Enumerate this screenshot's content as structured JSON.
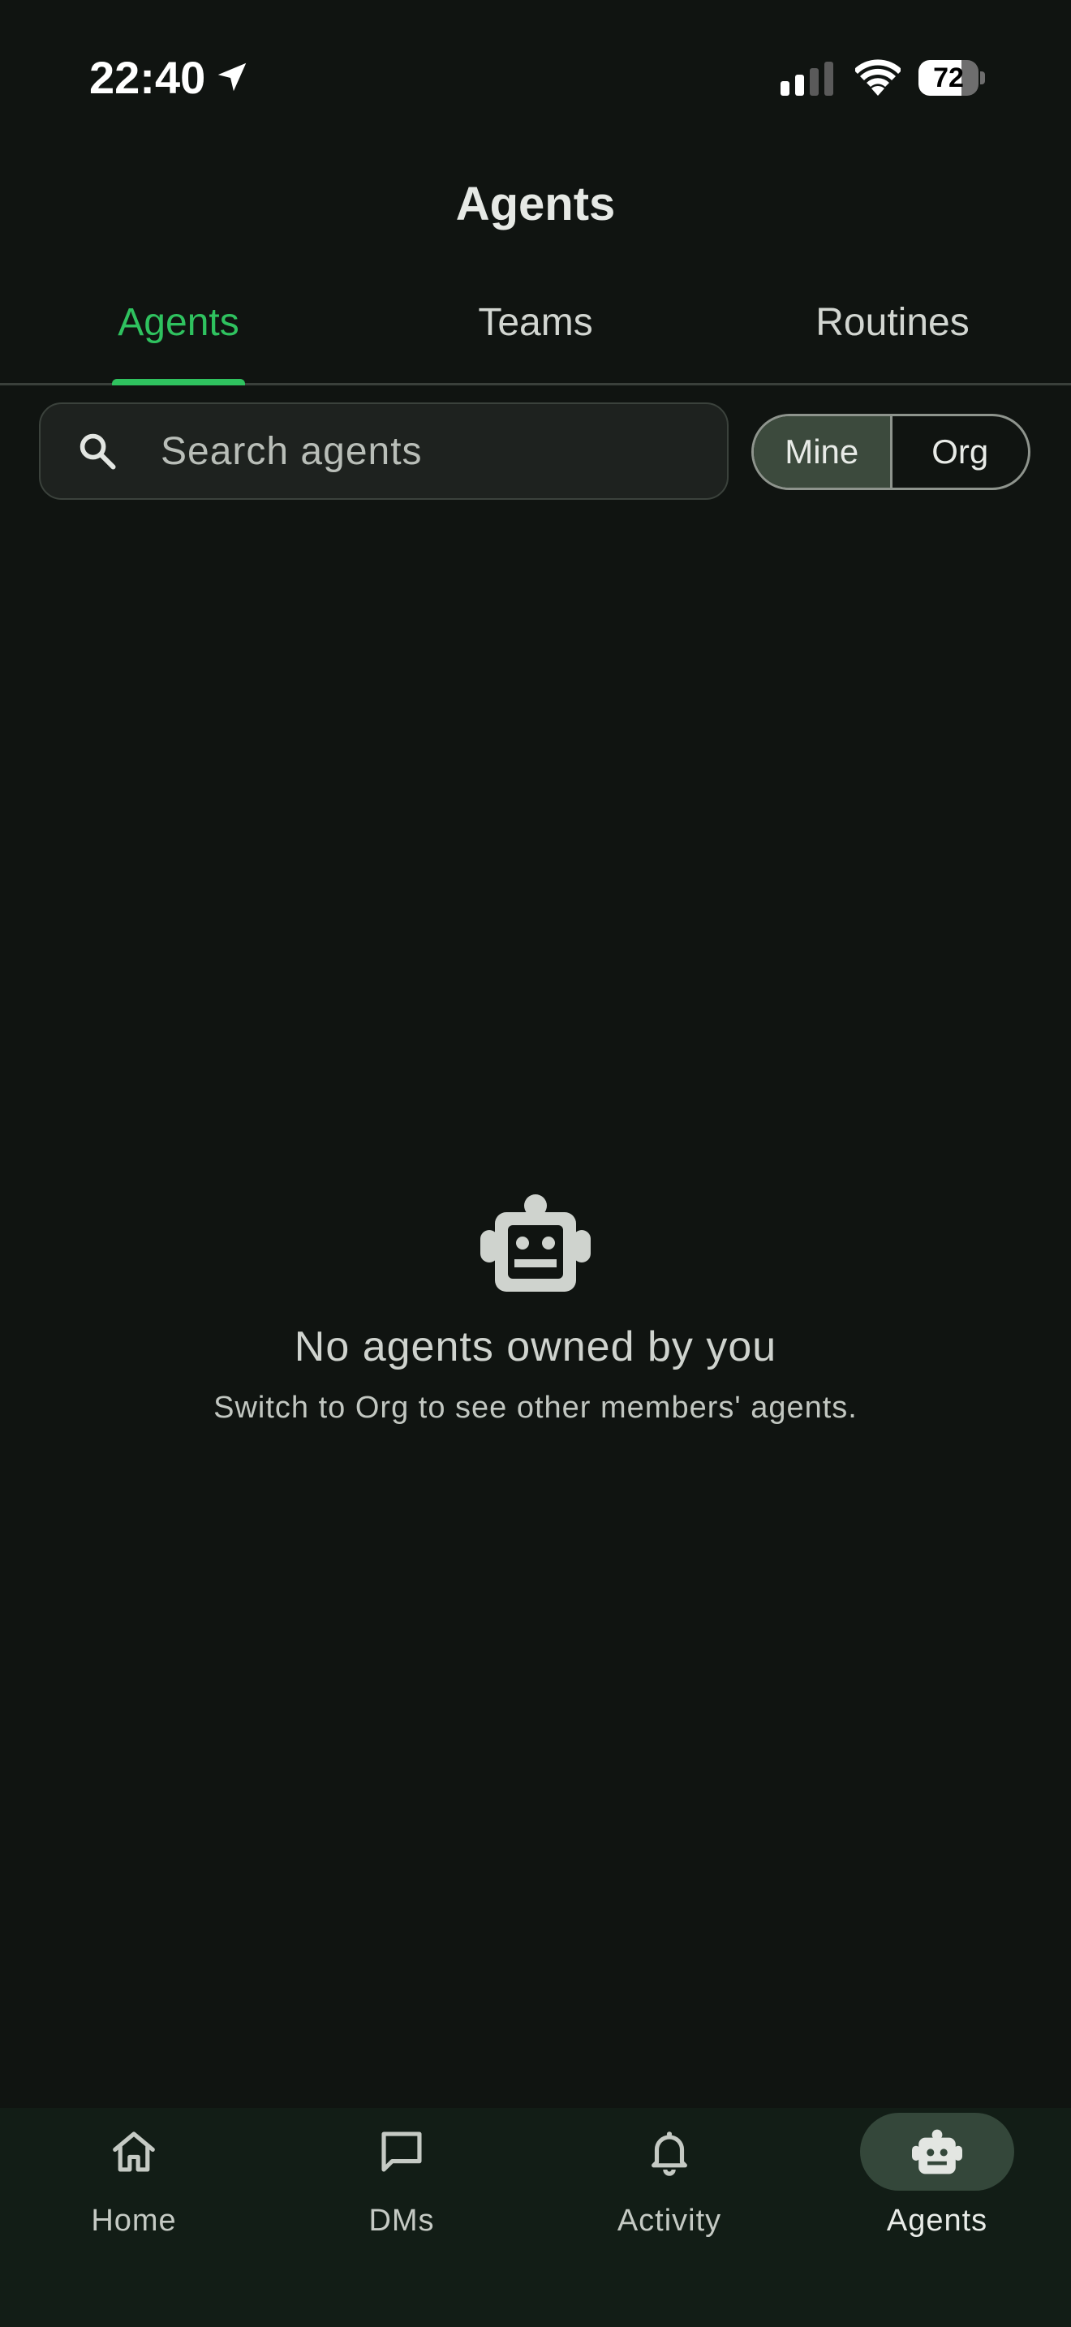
{
  "status_bar": {
    "time": "22:40",
    "battery_level": "72",
    "battery_fraction": 0.72,
    "icons": [
      "location-arrow-icon",
      "cellular-signal-icon",
      "wifi-icon",
      "battery-icon"
    ]
  },
  "header": {
    "title": "Agents"
  },
  "tabs": [
    {
      "label": "Agents",
      "active": true
    },
    {
      "label": "Teams",
      "active": false
    },
    {
      "label": "Routines",
      "active": false
    }
  ],
  "search": {
    "placeholder": "Search agents",
    "value": "",
    "icon": "search-icon"
  },
  "scope_toggle": {
    "options": [
      "Mine",
      "Org"
    ],
    "selected": "Mine"
  },
  "empty_state": {
    "icon": "robot-icon",
    "title": "No agents owned by you",
    "subtitle": "Switch to Org to see other members' agents."
  },
  "bottom_nav": {
    "items": [
      {
        "label": "Home",
        "icon": "home-icon",
        "active": false
      },
      {
        "label": "DMs",
        "icon": "chat-bubble-icon",
        "active": false
      },
      {
        "label": "Activity",
        "icon": "bell-icon",
        "active": false
      },
      {
        "label": "Agents",
        "icon": "robot-icon",
        "active": true
      }
    ]
  },
  "colors": {
    "background": "#101411",
    "accent": "#2fc25f",
    "nav_background": "#121d16",
    "nav_active_pill": "#34473a",
    "toggle_selected": "#3c4a3d"
  }
}
